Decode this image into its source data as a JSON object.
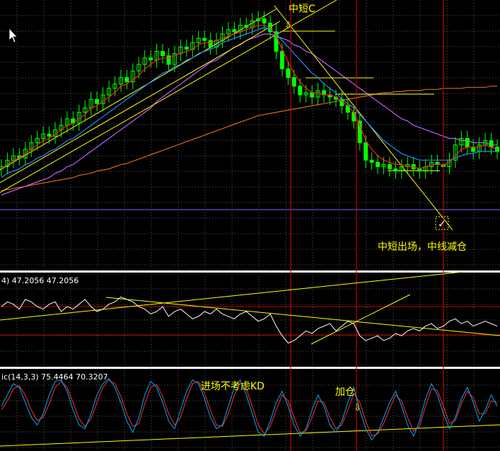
{
  "chart_data": {
    "type": "line",
    "colors": {
      "background": "#000000",
      "grid": "#5a5a5a",
      "candle": "#00ff00",
      "ma_red": "#ff2020",
      "ma_blue": "#1e90ff",
      "ma_violet": "#c060ff",
      "ma_orange": "#d2691e",
      "trendline": "#ffff00",
      "vline": "#cc0000",
      "hline_blue": "#7070ff",
      "oscillator": "#ffffff",
      "stoch_main": "#00aaff",
      "stoch_signal": "#ff3030",
      "annotation": "#ffff00"
    },
    "price_close": [
      2.1,
      2.4,
      2.6,
      2.5,
      2.9,
      3.2,
      3.4,
      3.6,
      3.5,
      3.8,
      4.0,
      4.3,
      4.1,
      4.6,
      4.8,
      5.2,
      5.0,
      5.4,
      5.7,
      5.9,
      6.2,
      6.0,
      6.5,
      6.8,
      7.1,
      7.0,
      7.4,
      7.2,
      6.8,
      7.3,
      7.6,
      7.5,
      7.8,
      8.0,
      7.9,
      7.6,
      7.9,
      8.2,
      8.4,
      8.3,
      8.6,
      8.5,
      8.8,
      8.9,
      8.7,
      8.3,
      7.4,
      6.6,
      6.2,
      5.8,
      5.4,
      5.5,
      5.3,
      5.6,
      5.4,
      5.3,
      5.2,
      4.9,
      4.6,
      4.2,
      3.2,
      2.4,
      2.3,
      2.1,
      2.2,
      2.0,
      1.9,
      2.1,
      2.2,
      2.0,
      1.9,
      2.1,
      2.3,
      2.2,
      2.1,
      2.4,
      3.1,
      3.4,
      3.0,
      2.8,
      3.1,
      3.3,
      3.0,
      2.8
    ],
    "ma_red": [
      2.0,
      2.2,
      2.4,
      2.5,
      2.7,
      2.9,
      3.1,
      3.3,
      3.4,
      3.6,
      3.8,
      4.0,
      4.1,
      4.3,
      4.5,
      4.8,
      4.9,
      5.1,
      5.3,
      5.5,
      5.8,
      5.9,
      6.1,
      6.3,
      6.6,
      6.8,
      7.0,
      7.1,
      7.1,
      7.2,
      7.3,
      7.4,
      7.5,
      7.7,
      7.8,
      7.8,
      7.9,
      8.0,
      8.1,
      8.2,
      8.3,
      8.4,
      8.5,
      8.6,
      8.6,
      8.5,
      8.1,
      7.5,
      6.9,
      6.4,
      6.0,
      5.7,
      5.5,
      5.5,
      5.4,
      5.4,
      5.3,
      5.1,
      4.9,
      4.6,
      4.0,
      3.3,
      2.9,
      2.6,
      2.4,
      2.3,
      2.2,
      2.2,
      2.1,
      2.1,
      2.0,
      2.1,
      2.2,
      2.2,
      2.2,
      2.3,
      2.6,
      2.9,
      3.0,
      3.0,
      3.0,
      3.1,
      3.0,
      2.9
    ],
    "ma_blue": [
      1.6,
      1.8,
      1.9,
      2.0,
      2.2,
      2.3,
      2.5,
      2.6,
      2.8,
      2.9,
      3.1,
      3.3,
      3.4,
      3.6,
      3.8,
      4.0,
      4.2,
      4.4,
      4.6,
      4.8,
      5.0,
      5.2,
      5.4,
      5.6,
      5.8,
      6.0,
      6.2,
      6.4,
      6.5,
      6.7,
      6.8,
      7.0,
      7.1,
      7.3,
      7.4,
      7.5,
      7.6,
      7.8,
      7.9,
      8.0,
      8.1,
      8.2,
      8.3,
      8.4,
      8.5,
      8.4,
      8.2,
      7.9,
      7.6,
      7.3,
      7.0,
      6.7,
      6.4,
      6.2,
      5.9,
      5.7,
      5.5,
      5.2,
      5.0,
      4.8,
      4.5,
      4.2,
      3.9,
      3.6,
      3.3,
      3.1,
      2.9,
      2.7,
      2.6,
      2.5,
      2.4,
      2.4,
      2.4,
      2.4,
      2.4,
      2.4,
      2.5,
      2.6,
      2.7,
      2.7,
      2.8,
      2.8,
      2.8,
      2.8
    ],
    "ma_violet": [
      0.8,
      0.9,
      1.0,
      1.1,
      1.2,
      1.3,
      1.4,
      1.5,
      1.6,
      1.8,
      1.9,
      2.1,
      2.2,
      2.4,
      2.6,
      2.8,
      3.0,
      3.2,
      3.4,
      3.6,
      3.8,
      4.0,
      4.2,
      4.4,
      4.6,
      4.8,
      5.1,
      5.3,
      5.5,
      5.7,
      5.9,
      6.1,
      6.3,
      6.5,
      6.7,
      6.9,
      7.0,
      7.2,
      7.4,
      7.6,
      7.7,
      7.9,
      8.0,
      8.1,
      8.2,
      8.2,
      8.1,
      8.0,
      7.9,
      7.7,
      7.6,
      7.4,
      7.3,
      7.1,
      6.9,
      6.7,
      6.5,
      6.3,
      6.1,
      5.9,
      5.7,
      5.5,
      5.3,
      5.1,
      4.9,
      4.7,
      4.5,
      4.3,
      4.2,
      4.0,
      3.9,
      3.8,
      3.7,
      3.6,
      3.5,
      3.4,
      3.4,
      3.3,
      3.3,
      3.2,
      3.2,
      3.2,
      3.1,
      3.1
    ],
    "ma_orange": [
      1.0,
      1.05,
      1.1,
      1.15,
      1.2,
      1.25,
      1.3,
      1.35,
      1.4,
      1.45,
      1.5,
      1.55,
      1.6,
      1.7,
      1.75,
      1.8,
      1.9,
      1.95,
      2.0,
      2.1,
      2.2,
      2.25,
      2.35,
      2.45,
      2.55,
      2.65,
      2.75,
      2.85,
      2.95,
      3.05,
      3.15,
      3.25,
      3.35,
      3.45,
      3.55,
      3.65,
      3.75,
      3.85,
      3.95,
      4.05,
      4.15,
      4.25,
      4.35,
      4.45,
      4.5,
      4.55,
      4.6,
      4.65,
      4.7,
      4.75,
      4.8,
      4.85,
      4.9,
      4.95,
      5.0,
      5.05,
      5.1,
      5.15,
      5.2,
      5.25,
      5.3,
      5.35,
      5.4,
      5.45,
      5.5,
      5.5,
      5.55,
      5.55,
      5.6,
      5.6,
      5.6,
      5.65,
      5.65,
      5.65,
      5.7,
      5.7,
      5.7,
      5.7,
      5.75,
      5.75,
      5.75,
      5.75,
      5.8,
      5.8
    ],
    "osc_label": "4)  47.2056  47.2056",
    "osc_values": [
      48,
      50,
      49,
      47,
      51,
      50,
      48,
      47,
      49,
      50,
      46,
      48,
      47,
      49,
      51,
      48,
      46,
      47,
      49,
      50,
      52,
      51,
      50,
      48,
      47,
      45,
      46,
      48,
      44,
      46,
      47,
      45,
      43,
      44,
      46,
      45,
      47,
      45,
      44,
      43,
      45,
      46,
      44,
      42,
      43,
      45,
      40,
      36,
      33,
      34,
      36,
      38,
      37,
      39,
      40,
      41,
      38,
      40,
      42,
      41,
      36,
      34,
      35,
      36,
      34,
      35,
      37,
      36,
      38,
      39,
      38,
      40,
      41,
      39,
      40,
      42,
      43,
      41,
      42,
      40,
      41,
      42,
      41,
      40
    ],
    "stoch_label": "ic(14,3,3)  75.4464  70.3207",
    "stoch_main": [
      55,
      70,
      85,
      80,
      60,
      40,
      30,
      45,
      70,
      88,
      90,
      75,
      50,
      30,
      25,
      45,
      70,
      85,
      92,
      80,
      60,
      35,
      20,
      40,
      70,
      88,
      80,
      60,
      35,
      25,
      50,
      75,
      90,
      85,
      65,
      40,
      25,
      30,
      55,
      80,
      90,
      70,
      45,
      20,
      15,
      35,
      60,
      75,
      55,
      30,
      15,
      25,
      50,
      70,
      55,
      30,
      20,
      35,
      60,
      80,
      50,
      25,
      10,
      20,
      40,
      60,
      75,
      55,
      30,
      15,
      35,
      65,
      85,
      70,
      45,
      25,
      40,
      65,
      80,
      60,
      35,
      50,
      70,
      55
    ],
    "stoch_signal": [
      50,
      62,
      78,
      82,
      70,
      50,
      36,
      40,
      58,
      80,
      88,
      80,
      60,
      38,
      28,
      38,
      60,
      80,
      90,
      85,
      68,
      45,
      28,
      32,
      58,
      80,
      84,
      68,
      45,
      30,
      40,
      65,
      85,
      88,
      72,
      50,
      30,
      28,
      45,
      70,
      86,
      78,
      55,
      30,
      18,
      28,
      50,
      70,
      62,
      40,
      20,
      22,
      40,
      62,
      60,
      40,
      25,
      30,
      50,
      72,
      60,
      35,
      15,
      18,
      32,
      52,
      70,
      62,
      40,
      22,
      28,
      55,
      78,
      76,
      55,
      32,
      36,
      58,
      75,
      66,
      45,
      45,
      62,
      60
    ],
    "annotations": {
      "zhong_duan_c": "中短C",
      "exit_note": "中短出场，中线减仓",
      "entry_note": "进场不考虑KD",
      "add_position": "加仓",
      "check": "✓",
      "arrow_down": "⇩"
    }
  }
}
